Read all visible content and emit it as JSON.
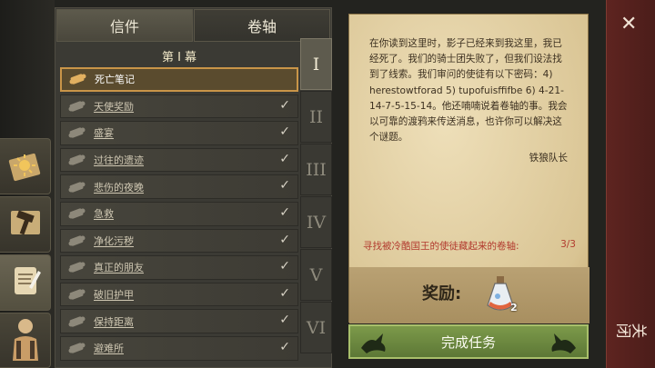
{
  "sidebar": {
    "icons": [
      {
        "name": "sun-book-icon"
      },
      {
        "name": "map-hammer-icon"
      },
      {
        "name": "quest-scroll-icon",
        "active": true
      },
      {
        "name": "character-icon"
      }
    ]
  },
  "tabs": {
    "letters": "信件",
    "scrolls": "卷轴"
  },
  "chapter": {
    "title": "第 I 幕"
  },
  "quests": [
    {
      "label": "死亡笔记",
      "selected": true,
      "done": false
    },
    {
      "label": "天使奖励",
      "selected": false,
      "done": true
    },
    {
      "label": "盛宴",
      "selected": false,
      "done": true
    },
    {
      "label": "过往的遗迹",
      "selected": false,
      "done": true
    },
    {
      "label": "悲伤的夜晚",
      "selected": false,
      "done": true
    },
    {
      "label": "急救",
      "selected": false,
      "done": true
    },
    {
      "label": "净化污秽",
      "selected": false,
      "done": true
    },
    {
      "label": "真正的朋友",
      "selected": false,
      "done": true
    },
    {
      "label": "破旧护甲",
      "selected": false,
      "done": true
    },
    {
      "label": "保持距离",
      "selected": false,
      "done": true
    },
    {
      "label": "避难所",
      "selected": false,
      "done": true
    }
  ],
  "chapters": [
    "I",
    "II",
    "III",
    "IV",
    "V",
    "VI"
  ],
  "letter": {
    "body": "在你读到这里时，影子已经来到我这里，我已经死了。我们的骑士团失败了，但我们设法找到了线索。我们审问的使徒有以下密码：4) herestowtforad 5) tupofuisffifbe 6) 4-21-14-7-5-15-14。他还喃喃说着卷轴的事。我会以可靠的渡鸦来传送消息，也许你可以解决这个谜题。",
    "signature": "铁狼队长",
    "objective": "寻找被冷酷国王的使徒藏起来的卷轴:",
    "objective_progress": "3/3"
  },
  "reward": {
    "label": "奖励:",
    "item_icon": "potion-flask-icon",
    "count": "2"
  },
  "complete_button": "完成任务",
  "close": {
    "label": "关闭"
  },
  "colors": {
    "accent_green": "#6a8a3e",
    "close_red": "#5a221e",
    "objective_red": "#b23a2e",
    "selected_gold": "#c99548"
  }
}
